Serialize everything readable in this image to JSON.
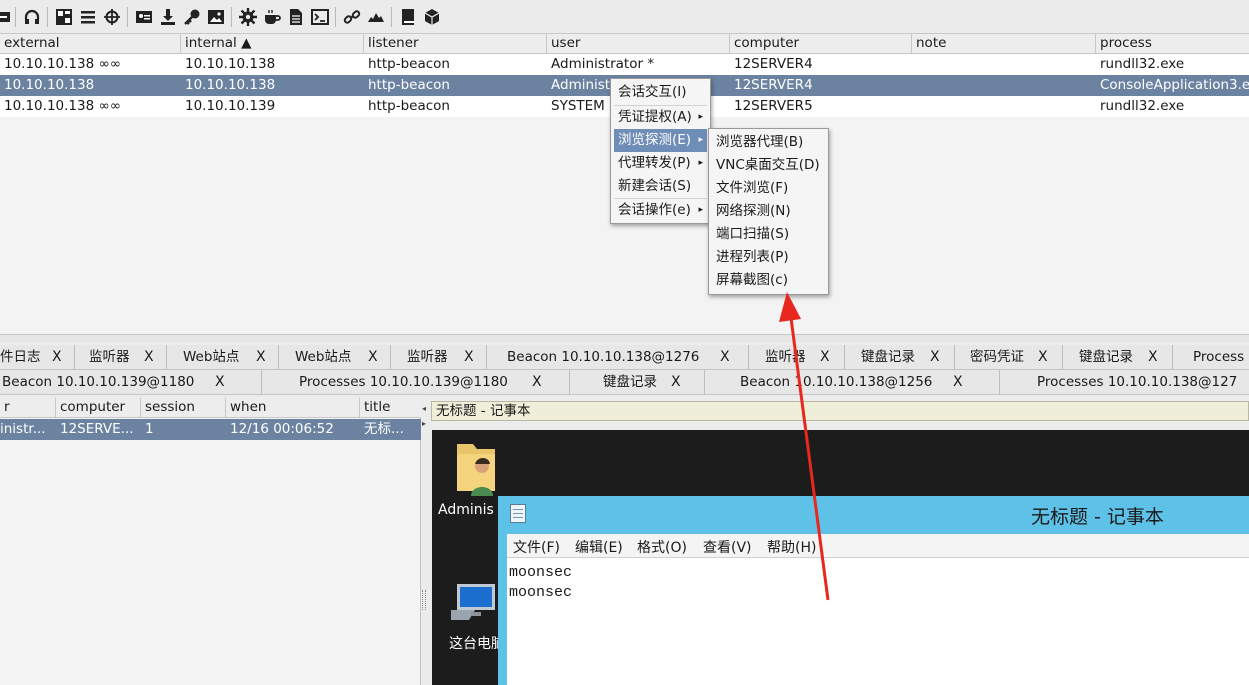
{
  "toolbar": {
    "icons": [
      "minus-icon",
      "headphones-icon",
      "graph-icon",
      "list-icon",
      "crosshair-icon",
      "contact-card-icon",
      "download-icon",
      "key-icon",
      "image-icon",
      "gear-icon",
      "coffee-cup-icon",
      "document-icon",
      "terminal-icon",
      "link-icon",
      "cloud-icon",
      "book-icon",
      "cube-icon"
    ]
  },
  "beacons": {
    "columns": [
      "external",
      "internal ▲",
      "listener",
      "user",
      "computer",
      "note",
      "process"
    ],
    "rows": [
      {
        "external": "10.10.10.138 ∞∞",
        "internal": "10.10.10.138",
        "listener": "http-beacon",
        "user": "Administrator *",
        "computer": "12SERVER4",
        "note": "",
        "process": "rundll32.exe"
      },
      {
        "external": "10.10.10.138",
        "internal": "10.10.10.138",
        "listener": "http-beacon",
        "user": "Administ",
        "computer": "12SERVER4",
        "note": "",
        "process": "ConsoleApplication3.e"
      },
      {
        "external": "10.10.10.138 ∞∞",
        "internal": "10.10.10.139",
        "listener": "http-beacon",
        "user": "SYSTEM",
        "computer": "12SERVER5",
        "note": "",
        "process": "rundll32.exe"
      }
    ],
    "selected_row": 1
  },
  "context_menu": {
    "items": [
      "会话交互(I)",
      "凭证提权(A)",
      "浏览探测(E)",
      "代理转发(P)",
      "新建会话(S)",
      "会话操作(e)"
    ],
    "highlighted": "浏览探测(E)"
  },
  "submenu": {
    "items": [
      "浏览器代理(B)",
      "VNC桌面交互(D)",
      "文件浏览(F)",
      "网络探测(N)",
      "端口扫描(S)",
      "进程列表(P)",
      "屏幕截图(c)"
    ]
  },
  "tabs_row1": [
    "件日志",
    "监听器",
    "Web站点",
    "Web站点",
    "监听器",
    "Beacon 10.10.10.138@1276",
    "监听器",
    "键盘记录",
    "密码凭证",
    "键盘记录",
    "Process"
  ],
  "tabs_row2": [
    "Beacon 10.10.10.139@1180",
    "Processes 10.10.10.139@1180",
    "键盘记录",
    "Beacon 10.10.10.138@1256",
    "Processes 10.10.10.138@127"
  ],
  "close_glyph": "X",
  "screenshots": {
    "columns": [
      "r",
      "computer",
      "session",
      "when",
      "title"
    ],
    "rows": [
      {
        "user": "inistr...",
        "computer": "12SERVE...",
        "session": "1",
        "when": "12/16 00:06:52",
        "title": "无标..."
      }
    ]
  },
  "preview": {
    "title": "无标题 - 记事本",
    "desktop_icons": [
      "Adminis",
      "这台电脑"
    ],
    "notepad_title": "无标题 - 记事本",
    "notepad_menu": [
      "文件(F)",
      "编辑(E)",
      "格式(O)",
      "查看(V)",
      "帮助(H)"
    ],
    "notepad_lines": [
      "moonsec",
      "moonsec"
    ]
  },
  "colors": {
    "selection": "#6b82a0",
    "menu_highlight": "#6f8eb7",
    "annotation_arrow": "#e8271e",
    "notepad_titlebar": "#5ec2e8"
  }
}
